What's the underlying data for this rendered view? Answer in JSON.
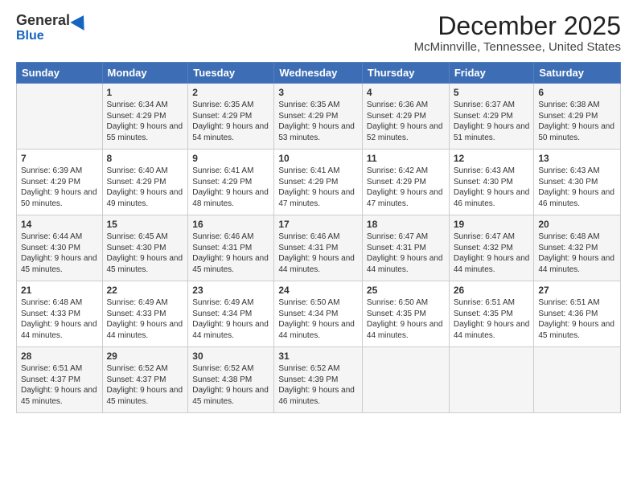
{
  "header": {
    "logo_general": "General",
    "logo_blue": "Blue",
    "title": "December 2025",
    "location": "McMinnville, Tennessee, United States"
  },
  "calendar": {
    "days_of_week": [
      "Sunday",
      "Monday",
      "Tuesday",
      "Wednesday",
      "Thursday",
      "Friday",
      "Saturday"
    ],
    "weeks": [
      [
        {
          "day": "",
          "sunrise": "",
          "sunset": "",
          "daylight": ""
        },
        {
          "day": "1",
          "sunrise": "Sunrise: 6:34 AM",
          "sunset": "Sunset: 4:29 PM",
          "daylight": "Daylight: 9 hours and 55 minutes."
        },
        {
          "day": "2",
          "sunrise": "Sunrise: 6:35 AM",
          "sunset": "Sunset: 4:29 PM",
          "daylight": "Daylight: 9 hours and 54 minutes."
        },
        {
          "day": "3",
          "sunrise": "Sunrise: 6:35 AM",
          "sunset": "Sunset: 4:29 PM",
          "daylight": "Daylight: 9 hours and 53 minutes."
        },
        {
          "day": "4",
          "sunrise": "Sunrise: 6:36 AM",
          "sunset": "Sunset: 4:29 PM",
          "daylight": "Daylight: 9 hours and 52 minutes."
        },
        {
          "day": "5",
          "sunrise": "Sunrise: 6:37 AM",
          "sunset": "Sunset: 4:29 PM",
          "daylight": "Daylight: 9 hours and 51 minutes."
        },
        {
          "day": "6",
          "sunrise": "Sunrise: 6:38 AM",
          "sunset": "Sunset: 4:29 PM",
          "daylight": "Daylight: 9 hours and 50 minutes."
        }
      ],
      [
        {
          "day": "7",
          "sunrise": "Sunrise: 6:39 AM",
          "sunset": "Sunset: 4:29 PM",
          "daylight": "Daylight: 9 hours and 50 minutes."
        },
        {
          "day": "8",
          "sunrise": "Sunrise: 6:40 AM",
          "sunset": "Sunset: 4:29 PM",
          "daylight": "Daylight: 9 hours and 49 minutes."
        },
        {
          "day": "9",
          "sunrise": "Sunrise: 6:41 AM",
          "sunset": "Sunset: 4:29 PM",
          "daylight": "Daylight: 9 hours and 48 minutes."
        },
        {
          "day": "10",
          "sunrise": "Sunrise: 6:41 AM",
          "sunset": "Sunset: 4:29 PM",
          "daylight": "Daylight: 9 hours and 47 minutes."
        },
        {
          "day": "11",
          "sunrise": "Sunrise: 6:42 AM",
          "sunset": "Sunset: 4:29 PM",
          "daylight": "Daylight: 9 hours and 47 minutes."
        },
        {
          "day": "12",
          "sunrise": "Sunrise: 6:43 AM",
          "sunset": "Sunset: 4:30 PM",
          "daylight": "Daylight: 9 hours and 46 minutes."
        },
        {
          "day": "13",
          "sunrise": "Sunrise: 6:43 AM",
          "sunset": "Sunset: 4:30 PM",
          "daylight": "Daylight: 9 hours and 46 minutes."
        }
      ],
      [
        {
          "day": "14",
          "sunrise": "Sunrise: 6:44 AM",
          "sunset": "Sunset: 4:30 PM",
          "daylight": "Daylight: 9 hours and 45 minutes."
        },
        {
          "day": "15",
          "sunrise": "Sunrise: 6:45 AM",
          "sunset": "Sunset: 4:30 PM",
          "daylight": "Daylight: 9 hours and 45 minutes."
        },
        {
          "day": "16",
          "sunrise": "Sunrise: 6:46 AM",
          "sunset": "Sunset: 4:31 PM",
          "daylight": "Daylight: 9 hours and 45 minutes."
        },
        {
          "day": "17",
          "sunrise": "Sunrise: 6:46 AM",
          "sunset": "Sunset: 4:31 PM",
          "daylight": "Daylight: 9 hours and 44 minutes."
        },
        {
          "day": "18",
          "sunrise": "Sunrise: 6:47 AM",
          "sunset": "Sunset: 4:31 PM",
          "daylight": "Daylight: 9 hours and 44 minutes."
        },
        {
          "day": "19",
          "sunrise": "Sunrise: 6:47 AM",
          "sunset": "Sunset: 4:32 PM",
          "daylight": "Daylight: 9 hours and 44 minutes."
        },
        {
          "day": "20",
          "sunrise": "Sunrise: 6:48 AM",
          "sunset": "Sunset: 4:32 PM",
          "daylight": "Daylight: 9 hours and 44 minutes."
        }
      ],
      [
        {
          "day": "21",
          "sunrise": "Sunrise: 6:48 AM",
          "sunset": "Sunset: 4:33 PM",
          "daylight": "Daylight: 9 hours and 44 minutes."
        },
        {
          "day": "22",
          "sunrise": "Sunrise: 6:49 AM",
          "sunset": "Sunset: 4:33 PM",
          "daylight": "Daylight: 9 hours and 44 minutes."
        },
        {
          "day": "23",
          "sunrise": "Sunrise: 6:49 AM",
          "sunset": "Sunset: 4:34 PM",
          "daylight": "Daylight: 9 hours and 44 minutes."
        },
        {
          "day": "24",
          "sunrise": "Sunrise: 6:50 AM",
          "sunset": "Sunset: 4:34 PM",
          "daylight": "Daylight: 9 hours and 44 minutes."
        },
        {
          "day": "25",
          "sunrise": "Sunrise: 6:50 AM",
          "sunset": "Sunset: 4:35 PM",
          "daylight": "Daylight: 9 hours and 44 minutes."
        },
        {
          "day": "26",
          "sunrise": "Sunrise: 6:51 AM",
          "sunset": "Sunset: 4:35 PM",
          "daylight": "Daylight: 9 hours and 44 minutes."
        },
        {
          "day": "27",
          "sunrise": "Sunrise: 6:51 AM",
          "sunset": "Sunset: 4:36 PM",
          "daylight": "Daylight: 9 hours and 45 minutes."
        }
      ],
      [
        {
          "day": "28",
          "sunrise": "Sunrise: 6:51 AM",
          "sunset": "Sunset: 4:37 PM",
          "daylight": "Daylight: 9 hours and 45 minutes."
        },
        {
          "day": "29",
          "sunrise": "Sunrise: 6:52 AM",
          "sunset": "Sunset: 4:37 PM",
          "daylight": "Daylight: 9 hours and 45 minutes."
        },
        {
          "day": "30",
          "sunrise": "Sunrise: 6:52 AM",
          "sunset": "Sunset: 4:38 PM",
          "daylight": "Daylight: 9 hours and 45 minutes."
        },
        {
          "day": "31",
          "sunrise": "Sunrise: 6:52 AM",
          "sunset": "Sunset: 4:39 PM",
          "daylight": "Daylight: 9 hours and 46 minutes."
        },
        {
          "day": "",
          "sunrise": "",
          "sunset": "",
          "daylight": ""
        },
        {
          "day": "",
          "sunrise": "",
          "sunset": "",
          "daylight": ""
        },
        {
          "day": "",
          "sunrise": "",
          "sunset": "",
          "daylight": ""
        }
      ]
    ]
  }
}
